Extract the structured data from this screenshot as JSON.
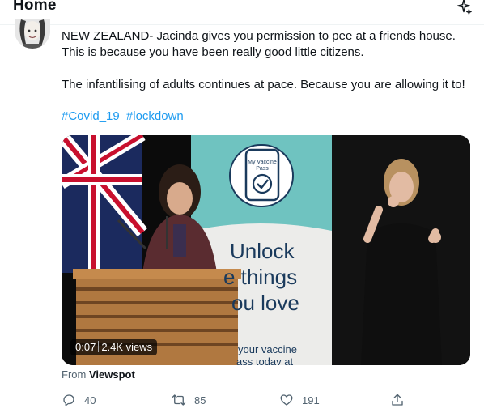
{
  "header": {
    "title": "Home"
  },
  "tweet": {
    "line1": "NEW ZEALAND- Jacinda gives you permission to pee at a friends house.",
    "line2": "This is because you have been really good little citizens.",
    "line3": "The infantilising of adults continues at pace. Because you are allowing it to!",
    "hashtags": [
      "#Covid_19",
      "#lockdown"
    ]
  },
  "video": {
    "duration": "0:07",
    "views": "2.4K views",
    "poster_text": {
      "pass_line1": "My Vaccine",
      "pass_line2": "Pass",
      "unlock": "Unlock",
      "things": "e things",
      "love": "ou love",
      "vaccine": "your vaccine",
      "today": "ass today at"
    }
  },
  "source": {
    "prefix": "From",
    "name": "Viewspot"
  },
  "actions": {
    "replies": "40",
    "retweets": "85",
    "likes": "191"
  },
  "icons": [
    "sparkle-icon",
    "reply-icon",
    "retweet-icon",
    "like-icon",
    "share-icon"
  ],
  "colors": {
    "accent": "#1d9bf0",
    "text": "#0f1419",
    "muted": "#536471"
  }
}
